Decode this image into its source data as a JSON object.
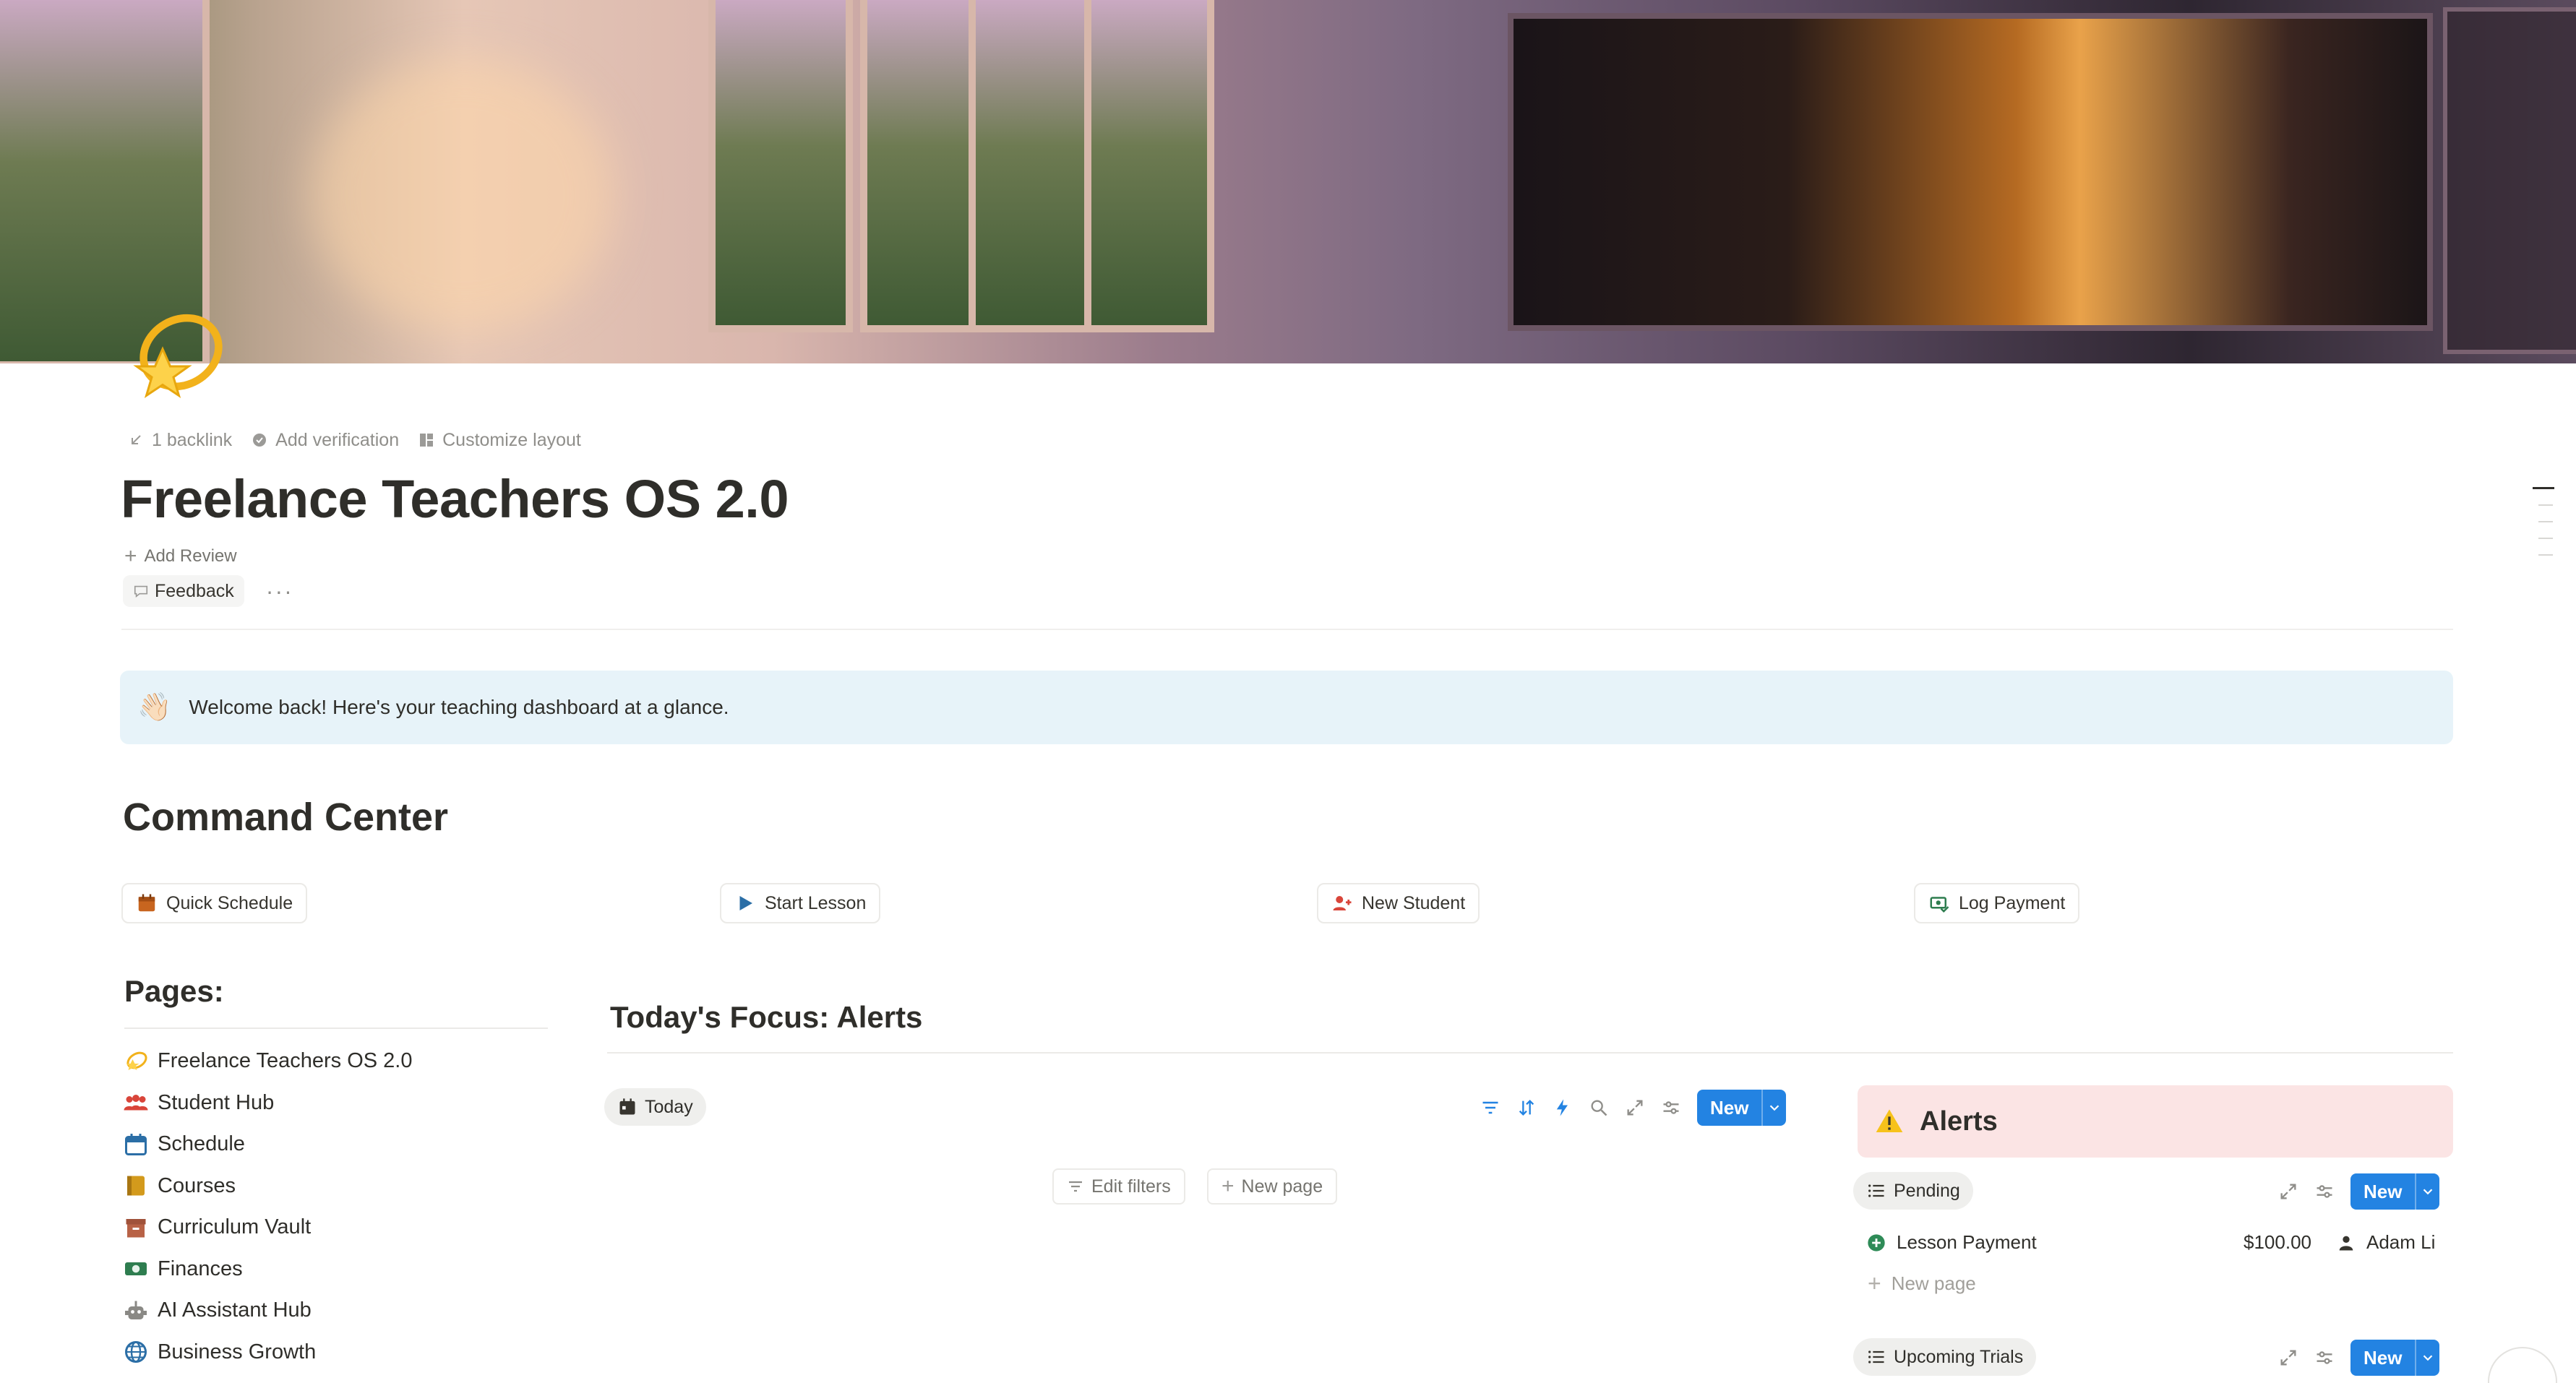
{
  "meta": {
    "backlink": "1 backlink",
    "verification": "Add verification",
    "customize": "Customize layout"
  },
  "page": {
    "title": "Freelance Teachers OS 2.0",
    "add_review": "Add Review",
    "feedback": "Feedback",
    "more": "···"
  },
  "callout": {
    "emoji": "👋🏻",
    "text": "Welcome back! Here's your teaching dashboard at a glance."
  },
  "command_center": {
    "heading": "Command Center",
    "buttons": [
      {
        "label": "Quick Schedule",
        "icon": "calendar-icon"
      },
      {
        "label": "Start Lesson",
        "icon": "play-icon"
      },
      {
        "label": "New Student",
        "icon": "add-person-icon"
      },
      {
        "label": "Log Payment",
        "icon": "money-icon"
      }
    ]
  },
  "pages": {
    "heading": "Pages:",
    "items": [
      {
        "label": "Freelance Teachers OS 2.0",
        "icon": "dizzy-star-icon"
      },
      {
        "label": "Student Hub",
        "icon": "people-icon"
      },
      {
        "label": "Schedule",
        "icon": "calendar-icon"
      },
      {
        "label": "Courses",
        "icon": "book-icon"
      },
      {
        "label": "Curriculum Vault",
        "icon": "archive-icon"
      },
      {
        "label": "Finances",
        "icon": "cash-icon"
      },
      {
        "label": "AI Assistant Hub",
        "icon": "robot-icon"
      },
      {
        "label": "Business Growth",
        "icon": "globe-icon"
      }
    ]
  },
  "focus": {
    "heading": "Today's Focus: Alerts",
    "view_tab": "Today",
    "new_label": "New",
    "edit_filters": "Edit filters",
    "new_page": "New page"
  },
  "alerts": {
    "heading": "Alerts",
    "pending_tab": "Pending",
    "new_label": "New",
    "row": {
      "title": "Lesson Payment",
      "amount": "$100.00",
      "person": "Adam Li"
    },
    "new_page": "New page",
    "trials_tab": "Upcoming Trials"
  },
  "colors": {
    "accent": "#2383e2",
    "callout_blue": "#e7f3f9",
    "callout_red": "#fbe4e4",
    "status_green": "#2e8b57"
  }
}
